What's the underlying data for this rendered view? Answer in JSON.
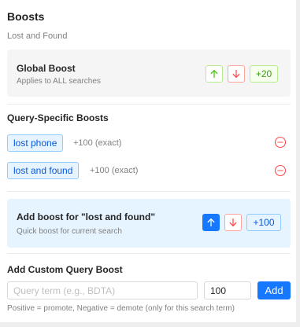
{
  "header": {
    "title": "Boosts",
    "subtitle": "Lost and Found"
  },
  "global_boost": {
    "title": "Global Boost",
    "description": "Applies to ALL searches",
    "value": "+20"
  },
  "query_boosts": {
    "title": "Query-Specific Boosts",
    "items": [
      {
        "term": "lost phone",
        "meta": "+100 (exact)"
      },
      {
        "term": "lost and found",
        "meta": "+100 (exact)"
      }
    ]
  },
  "quick_boost": {
    "title": "Add boost for \"lost and found\"",
    "description": "Quick boost for current search",
    "value": "+100"
  },
  "custom_boost": {
    "title": "Add Custom Query Boost",
    "query_placeholder": "Query term (e.g., BDTA)",
    "query_value": "",
    "amount_value": "100",
    "add_label": "Add",
    "help_text": "Positive = promote, Negative = demote (only for this search term)"
  },
  "colors": {
    "accent_blue": "#1677ff",
    "success_green": "#52c41a",
    "danger_red": "#ff4d4f"
  },
  "icons": {
    "up": "arrow-up-icon",
    "down": "arrow-down-icon",
    "remove": "minus-circle-icon"
  }
}
